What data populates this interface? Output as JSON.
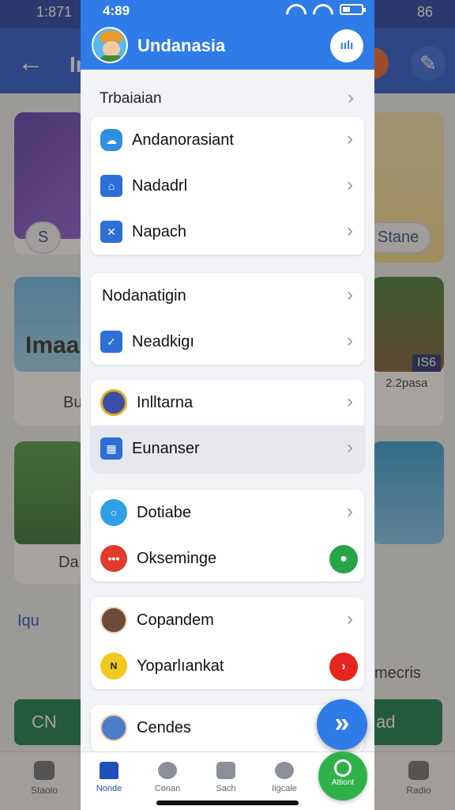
{
  "background_app": {
    "status_time": "1:871",
    "status_right": "86",
    "back_icon": "arrow-left-icon",
    "title": "In",
    "tool_icon": "wrench-icon",
    "cards": [
      {
        "pill_label": "S"
      },
      {
        "banner_text": "Imaa",
        "caption": "Bu"
      },
      {
        "caption": "Da"
      }
    ],
    "right_cards": [
      {
        "pill_label": "Stane"
      },
      {
        "badge": "IS6",
        "caption": "2.2pasa"
      }
    ],
    "list_text_left": "Iqu",
    "list_text_right": "mecris",
    "green_button_left": "CN",
    "green_button_right": "ad",
    "bottom_nav": [
      "Staoio",
      "Radio"
    ]
  },
  "drawer": {
    "status": {
      "time": "4:89"
    },
    "header": {
      "title": "Undanasia",
      "action_label": "ıılı",
      "avatar_icon": "profile-avatar-icon"
    },
    "section_label": "Trbaiaian",
    "groups": [
      {
        "items": [
          {
            "label": "Andanorasiant",
            "icon": "cloud-icon",
            "color": "#2f8fe0"
          },
          {
            "label": "Nadadrl",
            "icon": "home-icon",
            "color": "#2d6fd6"
          },
          {
            "label": "Napach",
            "icon": "box-icon",
            "color": "#2d6fd6"
          }
        ]
      },
      {
        "items": [
          {
            "label": "Nodanatigin",
            "icon": "",
            "color": ""
          },
          {
            "label": "Neadkigı",
            "icon": "edit-icon",
            "color": "#2d6fd6"
          }
        ]
      },
      {
        "items": [
          {
            "label": "Inlltarna",
            "icon": "globe-icon",
            "color": "#3a4fa8"
          },
          {
            "label": "Eunanser",
            "icon": "grid-icon",
            "color": "#2d6fd6",
            "highlight": true
          }
        ]
      },
      {
        "items": [
          {
            "label": "Dotiabe",
            "icon": "search-icon",
            "color": "#2fa0e8"
          },
          {
            "label": "Oksemingе",
            "icon": "dots-icon",
            "color": "#e13a2a",
            "badge_color": "#26a548"
          }
        ]
      },
      {
        "items": [
          {
            "label": "Copandem",
            "icon": "person-avatar-icon",
            "color": "#6b4a3a"
          },
          {
            "label": "Yoparlıankat",
            "icon": "coin-icon",
            "color": "#f2c81e",
            "badge_color": "#e5251e"
          }
        ]
      },
      {
        "items": [
          {
            "label": "Cendes",
            "icon": "person-avatar-icon",
            "color": "#4a7cc8"
          }
        ]
      }
    ],
    "fab_label": "»",
    "nav": [
      {
        "label": "Nonde",
        "icon": "home-icon",
        "active": true
      },
      {
        "label": "Conan",
        "icon": "circle-icon"
      },
      {
        "label": "Sach",
        "icon": "bag-icon"
      },
      {
        "label": "Iigcale",
        "icon": "minus-circle-icon"
      }
    ],
    "green_action": {
      "label": "Attiont",
      "icon": "ring-icon"
    }
  }
}
